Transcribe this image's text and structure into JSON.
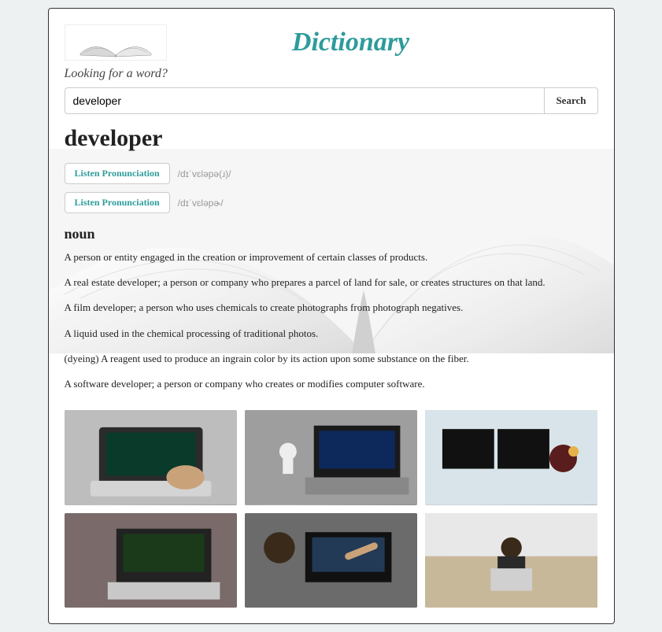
{
  "brand": "Dictionary",
  "tagline": "Looking for a word?",
  "search": {
    "value": "developer",
    "placeholder": "",
    "button": "Search"
  },
  "entry": {
    "word": "developer",
    "pronunciations": [
      {
        "button": "Listen Pronunciation",
        "ipa": "/dɪˈvɛləpə(ɹ)/"
      },
      {
        "button": "Listen Pronunciation",
        "ipa": "/dɪˈvɛləpɚ/"
      }
    ],
    "part_of_speech": "noun",
    "definitions": [
      "A person or entity engaged in the creation or improvement of certain classes of products.",
      "A real estate developer; a person or company who prepares a parcel of land for sale, or creates structures on that land.",
      "A film developer; a person who uses chemicals to create photographs from photograph negatives.",
      "A liquid used in the chemical processing of traditional photos.",
      "(dyeing) A reagent used to produce an ingrain color by its action upon some substance on the fiber.",
      "A software developer; a person or company who creates or modifies computer software."
    ]
  },
  "images": [
    {
      "alt": "laptop-coding-hands"
    },
    {
      "alt": "person-coffee-laptop-coding"
    },
    {
      "alt": "person-headphones-dual-monitor"
    },
    {
      "alt": "pair-laptop-code-screen"
    },
    {
      "alt": "people-pointing-laptop-screen"
    },
    {
      "alt": "person-standing-laptop-stickers"
    }
  ]
}
